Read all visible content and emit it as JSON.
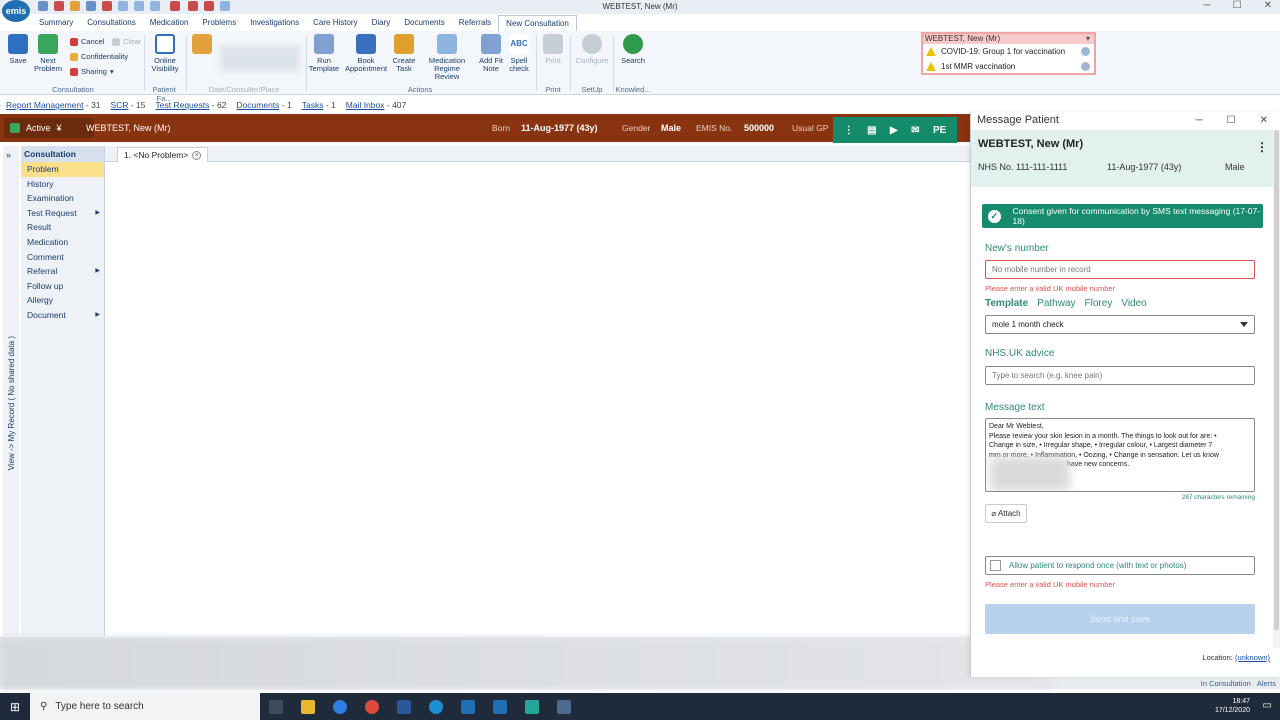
{
  "window": {
    "title": "WEBTEST, New (Mr)",
    "logo": "emis"
  },
  "nav_tabs": [
    "Summary",
    "Consultations",
    "Medication",
    "Problems",
    "Investigations",
    "Care History",
    "Diary",
    "Documents",
    "Referrals",
    "New Consultation"
  ],
  "ribbon": {
    "buttons": {
      "save": "Save",
      "next_problem": "Next Problem",
      "cancel": "Cancel",
      "clear": "Clear",
      "confidentiality": "Confidentiality",
      "sharing": "Sharing",
      "online_visibility": "Online Visibility",
      "run_template": "Run Template",
      "book_appointment": "Book Appointment",
      "create_task": "Create Task",
      "medication_regime_review": "Medication Regime Review",
      "add_fit_note": "Add Fit Note",
      "spell_check": "Spell check",
      "spell_check_top": "ABC",
      "print": "Print",
      "configure": "Configure",
      "search": "Search"
    },
    "groups": {
      "consultation": "Consultation",
      "patient_facing": "Patient Fa...",
      "date_place": "Date/Consulter/Place",
      "actions": "Actions",
      "print": "Print",
      "setup": "SetUp",
      "knowledge": "Knowled..."
    }
  },
  "alerts": {
    "title": "WEBTEST, New (Mr)",
    "items": [
      "COVID-19: Group 1 for vaccination",
      "1st MMR vaccination"
    ]
  },
  "infobar": [
    {
      "label": "Report Management",
      "count": "- 31"
    },
    {
      "label": "SCR",
      "count": "- 15"
    },
    {
      "label": "Test Requests",
      "count": "- 62"
    },
    {
      "label": "Documents",
      "count": "- 1"
    },
    {
      "label": "Tasks",
      "count": "- 1"
    },
    {
      "label": "Mail Inbox",
      "count": "- 407"
    }
  ],
  "patient_bar": {
    "status": "Active",
    "name": "WEBTEST, New (Mr)",
    "born_label": "Born",
    "born": "11-Aug-1977 (43y)",
    "gender_label": "Gender",
    "gender": "Male",
    "emis_label": "EMIS No.",
    "emis": "500000",
    "usual_gp_label": "Usual GP",
    "actions": [
      "PE"
    ]
  },
  "side_tab": "View -> My Record ( No shared data )",
  "consultation": {
    "header": "Consultation",
    "items": [
      {
        "label": "Problem",
        "arrow": false
      },
      {
        "label": "History",
        "arrow": false
      },
      {
        "label": "Examination",
        "arrow": false
      },
      {
        "label": "Test Request",
        "arrow": true
      },
      {
        "label": "Result",
        "arrow": false
      },
      {
        "label": "Medication",
        "arrow": false
      },
      {
        "label": "Comment",
        "arrow": false
      },
      {
        "label": "Referral",
        "arrow": true
      },
      {
        "label": "Follow up",
        "arrow": false
      },
      {
        "label": "Allergy",
        "arrow": false
      },
      {
        "label": "Document",
        "arrow": true
      }
    ]
  },
  "problem_tab": "1. <No Problem>",
  "message_panel": {
    "title": "Message Patient",
    "patient_name": "WEBTEST, New (Mr)",
    "nhs": "NHS No. 111-111-1111",
    "dob": "11-Aug-1977 (43y)",
    "gender": "Male",
    "consent": "Consent given for communication by SMS text messaging (17-07-18)",
    "number_label": "New's number",
    "number_placeholder": "No mobile number in record",
    "number_error": "Please enter a valid UK mobile number",
    "template_tabs": [
      "Template",
      "Pathway",
      "Florey",
      "Video"
    ],
    "template_value": "mole 1 month check",
    "nhs_advice_label": "NHS.UK advice",
    "nhs_advice_placeholder": "Type to search (e.g. knee pain)",
    "message_label": "Message text",
    "message_lines": [
      "Dear Mr Webtest,",
      "Please review your skin lesion in a month. The things to look out for are: •",
      "Change in size, • Irregular shape, • Irregular colour, • Largest diameter 7",
      "mm or more, • Inflammation, • Oozing, • Change in sensation. Let us know",
      "have new concerns."
    ],
    "chars_remaining": "287 characters remaining",
    "attach": "Attach",
    "allow_respond": "Allow patient to respond once (with text or photos)",
    "allow_error": "Please enter a valid UK mobile number",
    "send": "Send and save",
    "location_label": "Location:",
    "location_value": "(unknown)"
  },
  "status_bar": {
    "in_consultation": "In Consultation",
    "alerts": "Alerts"
  },
  "taskbar": {
    "search_placeholder": "Type here to search",
    "time": "18:47",
    "date": "17/12/2020"
  },
  "colors": {
    "brand_blue": "#1f6fb2",
    "patient_bar": "#8a3310",
    "teal": "#148b6b",
    "highlight": "#fbe08a"
  }
}
